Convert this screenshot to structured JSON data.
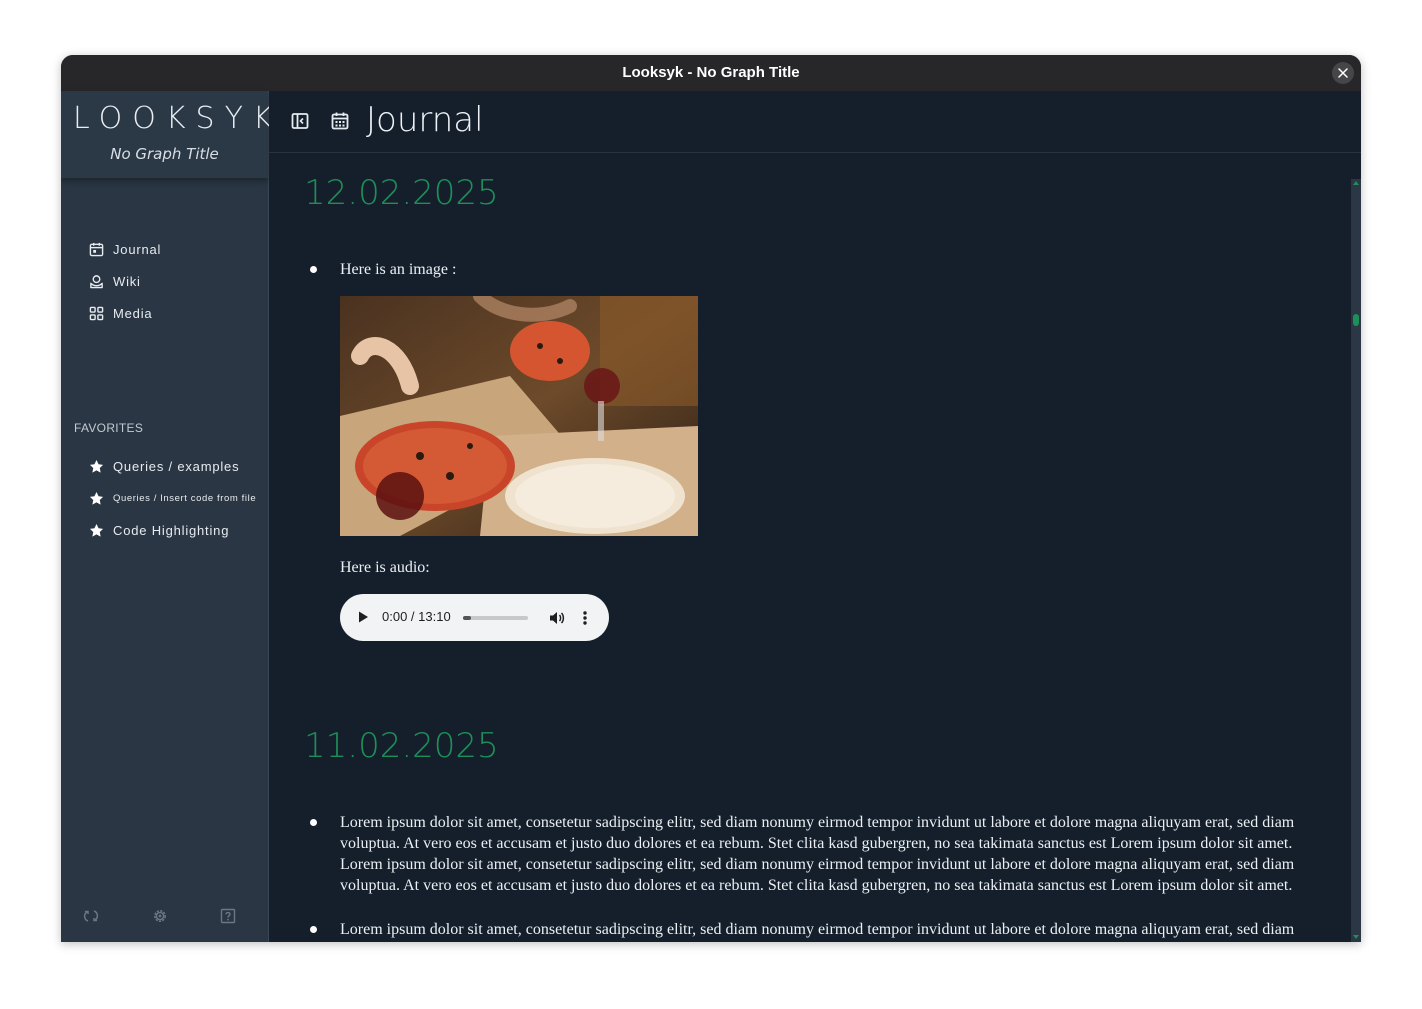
{
  "window": {
    "title": "Looksyk - No Graph Title"
  },
  "sidebar": {
    "logo": "LOOKSYK",
    "graph_title": "No Graph Title",
    "nav": [
      {
        "label": "Journal",
        "icon": "calendar-icon"
      },
      {
        "label": "Wiki",
        "icon": "wiki-icon"
      },
      {
        "label": "Media",
        "icon": "grid-icon"
      }
    ],
    "favorites_header": "FAVORITES",
    "favorites": [
      {
        "label": "Queries / examples",
        "icon": "star-icon"
      },
      {
        "label": "Queries / Insert code from file",
        "icon": "star-icon"
      },
      {
        "label": "Code Highlighting",
        "icon": "star-icon"
      }
    ],
    "footer": [
      "sync-icon",
      "settings-icon",
      "help-icon"
    ]
  },
  "header": {
    "title": "Journal",
    "buttons": [
      "toggle-sidebar-icon",
      "calendar-icon"
    ]
  },
  "journal": [
    {
      "date": "12.02.2025",
      "blocks": [
        {
          "text": "Here is an image :"
        },
        {
          "audio_label": "Here is audio:"
        }
      ],
      "audio": {
        "time": "0:00 / 13:10",
        "progress": 0.12
      }
    },
    {
      "date": "11.02.2025",
      "blocks": [
        {
          "text": "Lorem ipsum dolor sit amet, consetetur sadipscing elitr, sed diam nonumy eirmod tempor invidunt ut labore et dolore magna aliquyam erat, sed diam voluptua. At vero eos et accusam et justo duo dolores et ea rebum. Stet clita kasd gubergren, no sea takimata sanctus est Lorem ipsum dolor sit amet. Lorem ipsum dolor sit amet, consetetur sadipscing elitr, sed diam nonumy eirmod tempor invidunt ut labore et dolore magna aliquyam erat, sed diam voluptua. At vero eos et accusam et justo duo dolores et ea rebum. Stet clita kasd gubergren, no sea takimata sanctus est Lorem ipsum dolor sit amet."
        },
        {
          "text": "Lorem ipsum dolor sit amet, consetetur sadipscing elitr, sed diam nonumy eirmod tempor invidunt ut labore et dolore magna aliquyam erat, sed diam voluptua."
        }
      ]
    }
  ],
  "colors": {
    "accent": "#1e8f59",
    "sidebar_bg": "#2a3643",
    "main_bg": "#141f2b",
    "titlebar_bg": "#27272a"
  }
}
